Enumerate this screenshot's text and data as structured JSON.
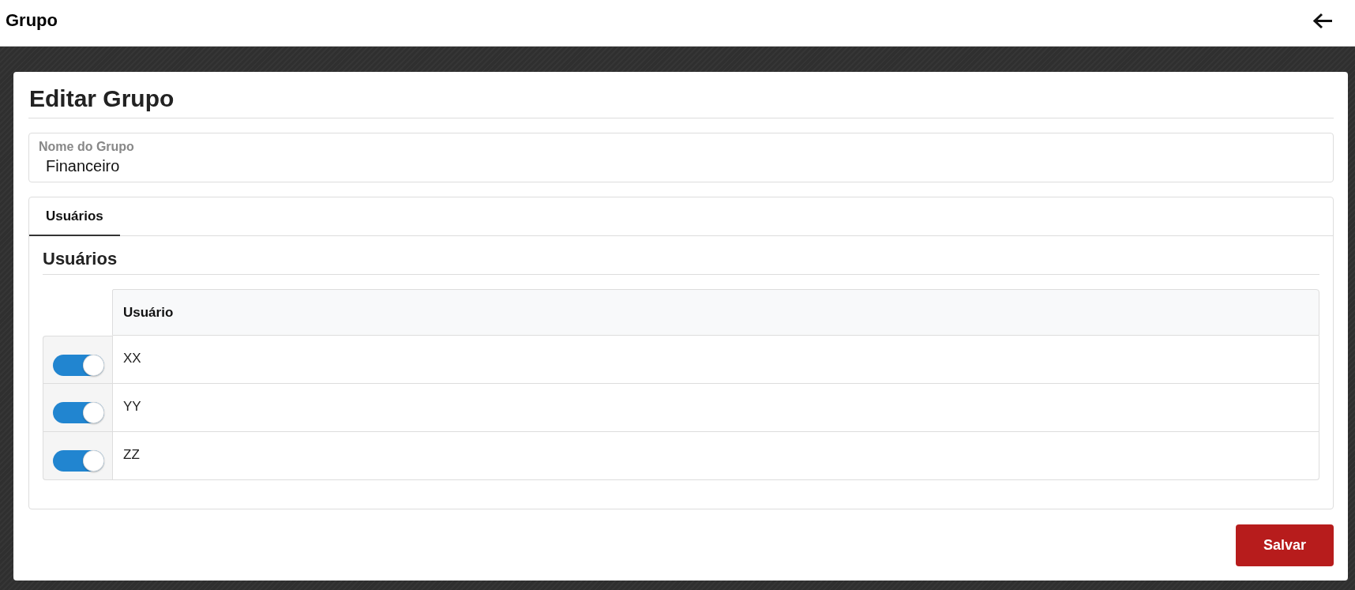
{
  "header": {
    "title": "Grupo"
  },
  "page": {
    "title": "Editar Grupo"
  },
  "form": {
    "fields": [
      {
        "label": "Nome do Grupo",
        "value": "Financeiro"
      }
    ]
  },
  "tabs": [
    {
      "label": "Usuários",
      "selected": true
    }
  ],
  "panel": {
    "title": "Usuários",
    "table": {
      "columns": [
        "Usuário"
      ],
      "rows": [
        {
          "on": true,
          "name": "XX"
        },
        {
          "on": true,
          "name": "YY"
        },
        {
          "on": true,
          "name": "ZZ"
        }
      ]
    }
  },
  "buttons": [
    {
      "label": "Salvar",
      "kind": "primary"
    }
  ]
}
